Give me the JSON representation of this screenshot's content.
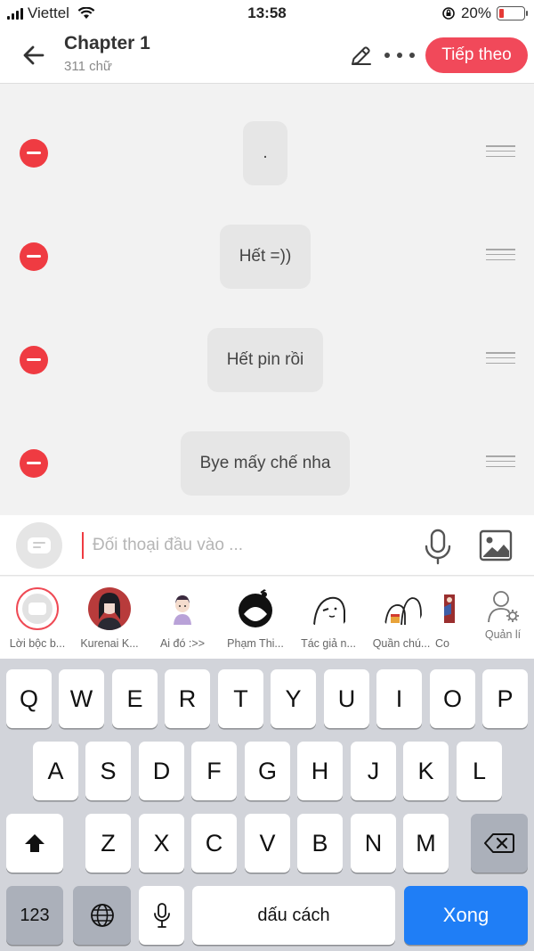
{
  "status_bar": {
    "carrier": "Viettel",
    "time": "13:58",
    "battery_percent": "20%",
    "battery_level": 0.2
  },
  "header": {
    "title": "Chapter 1",
    "word_count": "311 chữ",
    "next_label": "Tiếp theo"
  },
  "messages": [
    {
      "text": "."
    },
    {
      "text": "Hết =))"
    },
    {
      "text": "Hết pin rồi"
    },
    {
      "text": "Bye mấy chế nha"
    }
  ],
  "input": {
    "placeholder": "Đối thoại đầu vào ..."
  },
  "characters": [
    {
      "label": "Lời bộc b..."
    },
    {
      "label": "Kurenai K..."
    },
    {
      "label": "Ai đó :>>"
    },
    {
      "label": "Phạm Thi..."
    },
    {
      "label": "Tác giả n..."
    },
    {
      "label": "Quần chú..."
    },
    {
      "label": "Co"
    }
  ],
  "manage_label": "Quản lí",
  "keyboard": {
    "row1": [
      "Q",
      "W",
      "E",
      "R",
      "T",
      "Y",
      "U",
      "I",
      "O",
      "P"
    ],
    "row2": [
      "A",
      "S",
      "D",
      "F",
      "G",
      "H",
      "J",
      "K",
      "L"
    ],
    "row3": [
      "Z",
      "X",
      "C",
      "V",
      "B",
      "N",
      "M"
    ],
    "numbers_key": "123",
    "space_key": "dấu cách",
    "done_key": "Xong"
  },
  "colors": {
    "accent": "#f1495a",
    "remove": "#ef3b42",
    "done_key": "#1f7ef6"
  }
}
